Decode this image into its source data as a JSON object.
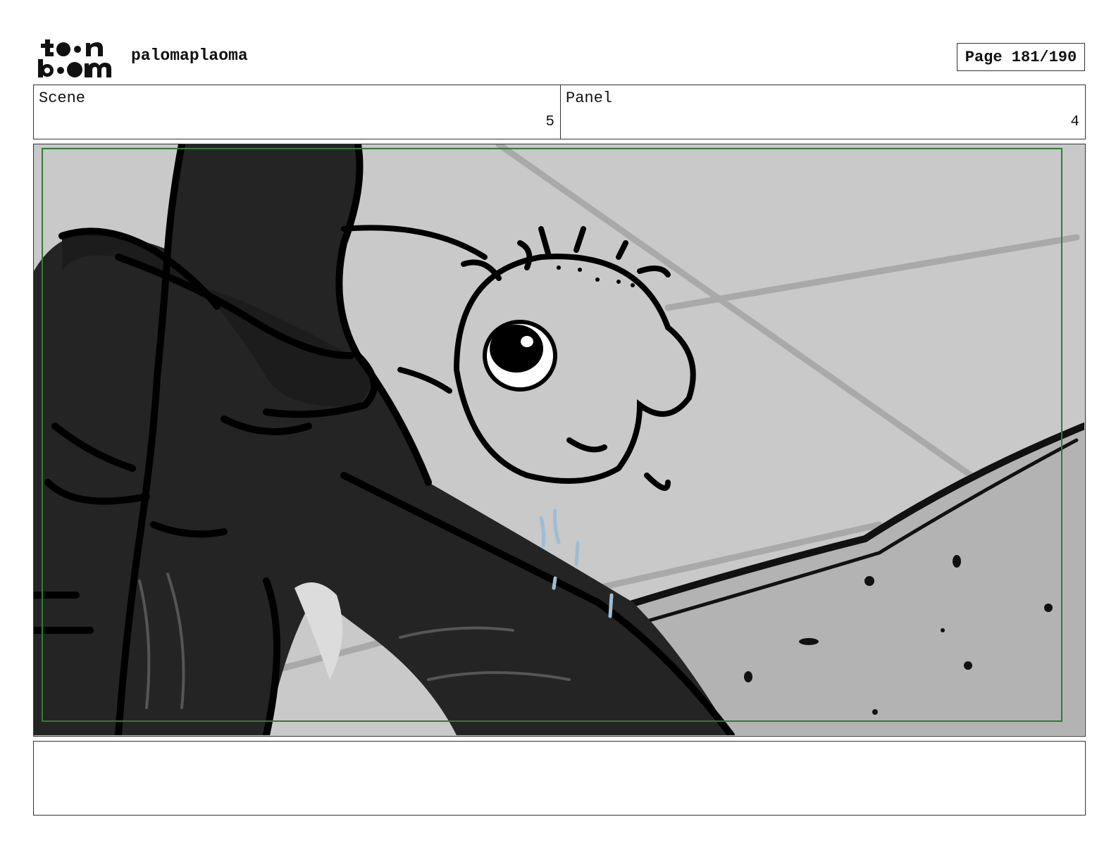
{
  "header": {
    "logo_text_top": "toon",
    "logo_text_bottom": "boom",
    "project_name": "palomaplaoma",
    "page_label": "Page 181/190"
  },
  "info": {
    "scene_label": "Scene",
    "scene_value": "5",
    "panel_label": "Panel",
    "panel_value": "4"
  },
  "frame": {
    "safe_area_color": "#2e7d32",
    "background_color": "#c9c9c9"
  },
  "notes": {
    "text": ""
  }
}
